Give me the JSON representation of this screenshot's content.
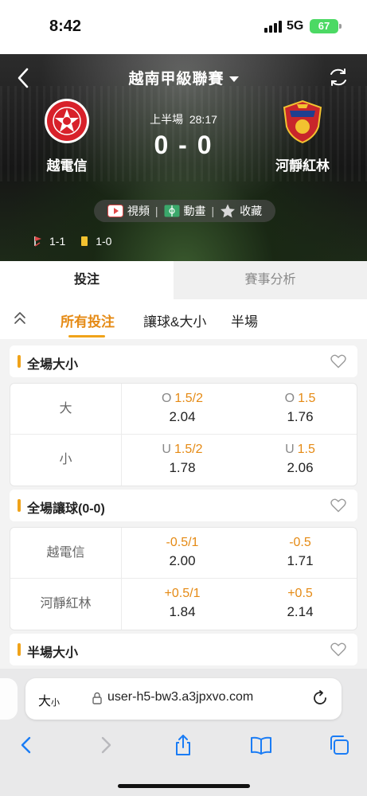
{
  "status_bar": {
    "time": "8:42",
    "network": "5G",
    "battery": "67"
  },
  "header": {
    "league": "越南甲級聯賽"
  },
  "match": {
    "home_team": "越電信",
    "away_team": "河靜紅林",
    "period": "上半場",
    "clock": "28:17",
    "score": "0 - 0"
  },
  "actions": {
    "video": "視頻",
    "animation": "動畫",
    "favorite": "收藏"
  },
  "cards": {
    "corners": "1-1",
    "yellow": "1-0"
  },
  "main_tabs": [
    {
      "label": "投注",
      "active": true
    },
    {
      "label": "賽事分析",
      "active": false
    }
  ],
  "sub_tabs": [
    {
      "label": "所有投注",
      "active": true
    },
    {
      "label": "讓球&大小",
      "active": false
    },
    {
      "label": "半場",
      "active": false
    }
  ],
  "markets": [
    {
      "title": "全場大小",
      "rows": [
        {
          "label": "大",
          "cells": [
            {
              "prefix": "O",
              "handicap": "1.5/2",
              "odds": "2.04"
            },
            {
              "prefix": "O",
              "handicap": "1.5",
              "odds": "1.76"
            }
          ]
        },
        {
          "label": "小",
          "cells": [
            {
              "prefix": "U",
              "handicap": "1.5/2",
              "odds": "1.78"
            },
            {
              "prefix": "U",
              "handicap": "1.5",
              "odds": "2.06"
            }
          ]
        }
      ]
    },
    {
      "title": "全場讓球(0-0)",
      "rows": [
        {
          "label": "越電信",
          "cells": [
            {
              "prefix": "",
              "handicap": "-0.5/1",
              "odds": "2.00"
            },
            {
              "prefix": "",
              "handicap": "-0.5",
              "odds": "1.71"
            }
          ]
        },
        {
          "label": "河靜紅林",
          "cells": [
            {
              "prefix": "",
              "handicap": "+0.5/1",
              "odds": "1.84"
            },
            {
              "prefix": "",
              "handicap": "+0.5",
              "odds": "2.14"
            }
          ]
        }
      ]
    },
    {
      "title": "半場大小",
      "rows": []
    }
  ],
  "browser": {
    "text_size": "大",
    "text_size_small": "小",
    "url": "user-h5-bw3.a3jpxvo.com"
  },
  "colors": {
    "accent": "#f0a31a",
    "accent_text": "#e58a14",
    "ios_blue": "#1a7cf5"
  },
  "icons": [
    "back-icon",
    "caret-down-icon",
    "refresh-icon",
    "video-icon",
    "animation-icon",
    "star-icon",
    "corner-flag-icon",
    "yellow-card-icon",
    "collapse-icon",
    "heart-icon",
    "lock-icon",
    "reload-icon",
    "nav-back-icon",
    "nav-forward-icon",
    "share-icon",
    "bookmarks-icon",
    "tabs-icon"
  ]
}
